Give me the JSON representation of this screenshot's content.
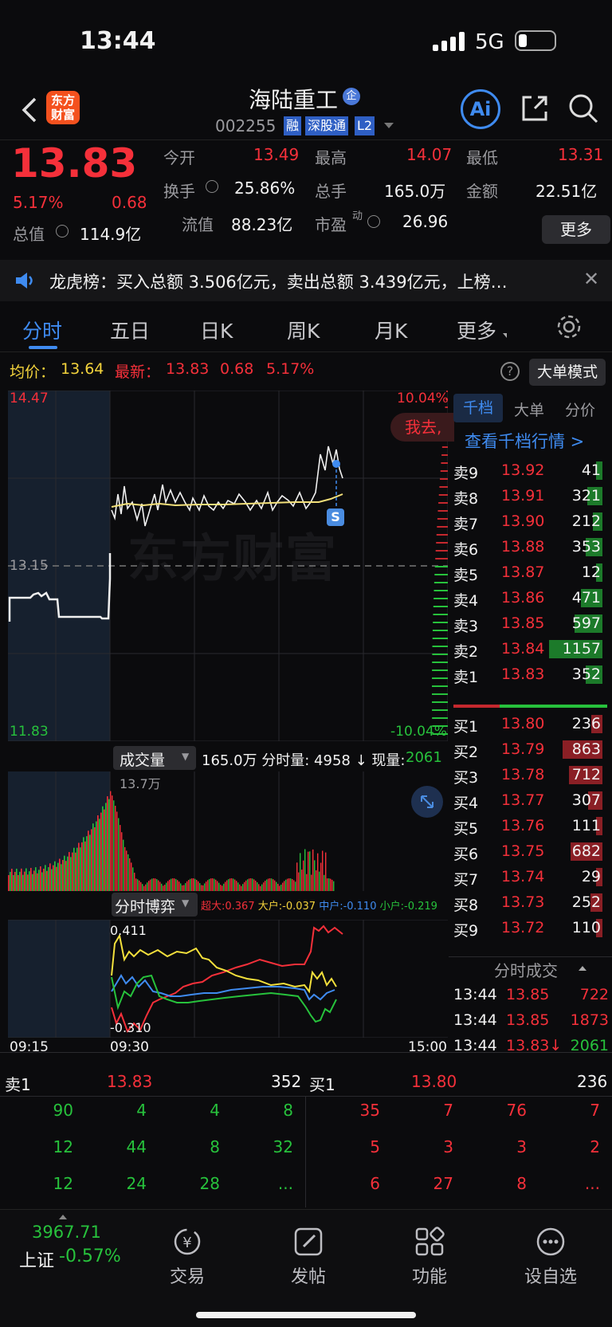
{
  "status": {
    "time": "13:44",
    "network": "5G"
  },
  "header": {
    "back_icon": "chevron-left-icon",
    "logo_text": "东方\n财富",
    "stock_name": "海陆重工",
    "badge_qi": "企",
    "code": "002255",
    "tags": [
      "融",
      "深股通",
      "L2"
    ],
    "ai_label": "Ai"
  },
  "quote": {
    "price": "13.83",
    "pct": "5.17%",
    "chg": "0.68",
    "today_open_label": "今开",
    "today_open": "13.49",
    "high_label": "最高",
    "high": "14.07",
    "low_label": "最低",
    "low": "13.31",
    "turnover_label": "换手",
    "turnover": "25.86%",
    "volume_label": "总手",
    "volume": "165.0万",
    "amount_label": "金额",
    "amount": "22.51亿",
    "mktcap_label": "总值",
    "mktcap": "114.9亿",
    "float_label": "流值",
    "float": "88.23亿",
    "pe_label": "市盈",
    "pe_sup": "动",
    "pe": "26.96",
    "more_label": "更多"
  },
  "notice": {
    "text": "龙虎榜：买入总额 3.506亿元，卖出总额 3.439亿元，上榜…"
  },
  "tabs": [
    "分时",
    "五日",
    "日K",
    "周K",
    "月K",
    "更多"
  ],
  "intraday": {
    "avg_label": "均价：",
    "avg": "13.64",
    "latest_label": "最新：",
    "latest": "13.83",
    "latest_chg": "0.68",
    "latest_pct": "5.17%",
    "big_order_mode": "大单模式",
    "y_top": "14.47",
    "y_mid": "13.15",
    "y_bottom": "11.83",
    "pct_top": "10.04%",
    "pct_bottom": "-10.04%",
    "goto_label": "我去,",
    "watermark": "东方财富",
    "marker": "S",
    "vol_selector": "成交量",
    "vol_info": "165.0万 分时量: 4958 ↓ 现量:",
    "vol_now": "2061",
    "vol_max": "13.7万",
    "game_selector": "分时博弈",
    "game_super": "超大:0.367",
    "game_big": "大户:-0.037",
    "game_mid": "中户:-0.110",
    "game_small": "小户:-0.219",
    "game_top": "0.411",
    "game_bottom": "-0.310",
    "time_start": "09:15",
    "time_open": "09:30",
    "time_end": "15:00"
  },
  "book": {
    "tabs": [
      "千档",
      "大单",
      "分价"
    ],
    "link": "查看千档行情 >",
    "asks": [
      {
        "label": "卖9",
        "price": "13.92",
        "vol": "41"
      },
      {
        "label": "卖8",
        "price": "13.91",
        "vol": "321"
      },
      {
        "label": "卖7",
        "price": "13.90",
        "vol": "212"
      },
      {
        "label": "卖6",
        "price": "13.88",
        "vol": "353"
      },
      {
        "label": "卖5",
        "price": "13.87",
        "vol": "12"
      },
      {
        "label": "卖4",
        "price": "13.86",
        "vol": "471"
      },
      {
        "label": "卖3",
        "price": "13.85",
        "vol": "597"
      },
      {
        "label": "卖2",
        "price": "13.84",
        "vol": "1157"
      },
      {
        "label": "卖1",
        "price": "13.83",
        "vol": "352"
      }
    ],
    "bids": [
      {
        "label": "买1",
        "price": "13.80",
        "vol": "236"
      },
      {
        "label": "买2",
        "price": "13.79",
        "vol": "863"
      },
      {
        "label": "买3",
        "price": "13.78",
        "vol": "712"
      },
      {
        "label": "买4",
        "price": "13.77",
        "vol": "307"
      },
      {
        "label": "买5",
        "price": "13.76",
        "vol": "111"
      },
      {
        "label": "买6",
        "price": "13.75",
        "vol": "682"
      },
      {
        "label": "买7",
        "price": "13.74",
        "vol": "29"
      },
      {
        "label": "买8",
        "price": "13.73",
        "vol": "252"
      },
      {
        "label": "买9",
        "price": "13.72",
        "vol": "110"
      }
    ],
    "trades_title": "分时成交",
    "trades": [
      {
        "time": "13:44",
        "price": "13.85",
        "vol": "722"
      },
      {
        "time": "13:44",
        "price": "13.85",
        "vol": "1873"
      },
      {
        "time": "13:44",
        "price": "13.83↓",
        "vol": "2061"
      }
    ]
  },
  "queue": {
    "sell_label": "卖1",
    "sell_price": "13.83",
    "sell_vol": "352",
    "buy_label": "买1",
    "buy_price": "13.80",
    "buy_vol": "236",
    "sell_rows": [
      [
        "90",
        "4",
        "4",
        "8"
      ],
      [
        "12",
        "44",
        "8",
        "32"
      ],
      [
        "12",
        "24",
        "28",
        "..."
      ]
    ],
    "buy_rows": [
      [
        "35",
        "7",
        "76",
        "7"
      ],
      [
        "5",
        "3",
        "3",
        "2"
      ],
      [
        "6",
        "27",
        "8",
        "..."
      ]
    ]
  },
  "bottom_nav": {
    "index_value": "3967.71",
    "index_name": "上证",
    "index_pct": "-0.57%",
    "items": [
      "交易",
      "发帖",
      "功能",
      "设自选"
    ]
  }
}
